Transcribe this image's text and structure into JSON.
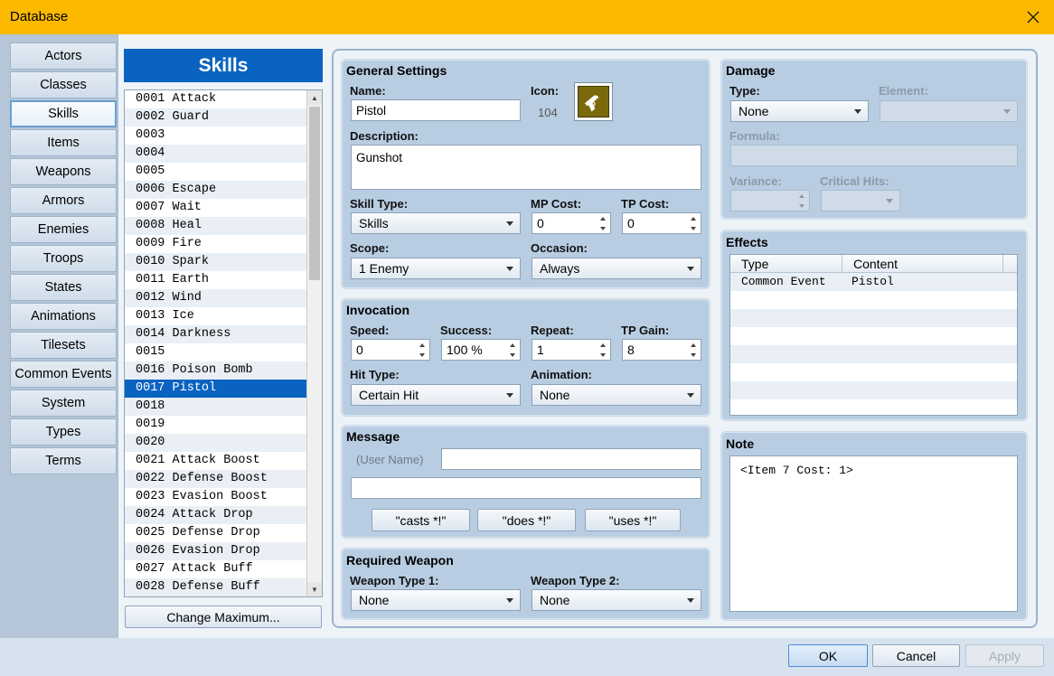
{
  "window": {
    "title": "Database",
    "close_icon": "close-icon"
  },
  "categories": [
    "Actors",
    "Classes",
    "Skills",
    "Items",
    "Weapons",
    "Armors",
    "Enemies",
    "Troops",
    "States",
    "Animations",
    "Tilesets",
    "Common Events",
    "System",
    "Types",
    "Terms"
  ],
  "active_category": "Skills",
  "list_panel": {
    "header": "Skills",
    "items": [
      "0001 Attack",
      "0002 Guard",
      "0003",
      "0004",
      "0005",
      "0006 Escape",
      "0007 Wait",
      "0008 Heal",
      "0009 Fire",
      "0010 Spark",
      "0011 Earth",
      "0012 Wind",
      "0013 Ice",
      "0014 Darkness",
      "0015",
      "0016 Poison Bomb",
      "0017 Pistol",
      "0018",
      "0019",
      "0020",
      "0021 Attack Boost",
      "0022 Defense Boost",
      "0023 Evasion Boost",
      "0024 Attack Drop",
      "0025 Defense Drop",
      "0026 Evasion Drop",
      "0027 Attack Buff",
      "0028 Defense Buff"
    ],
    "selected_index": 16,
    "change_max_label": "Change Maximum..."
  },
  "general": {
    "title": "General Settings",
    "name_label": "Name:",
    "name_value": "Pistol",
    "icon_label": "Icon:",
    "icon_index": "104",
    "description_label": "Description:",
    "description_value": "Gunshot",
    "skill_type_label": "Skill Type:",
    "skill_type_value": "Skills",
    "mp_cost_label": "MP Cost:",
    "mp_cost_value": "0",
    "tp_cost_label": "TP Cost:",
    "tp_cost_value": "0",
    "scope_label": "Scope:",
    "scope_value": "1 Enemy",
    "occasion_label": "Occasion:",
    "occasion_value": "Always"
  },
  "invocation": {
    "title": "Invocation",
    "speed_label": "Speed:",
    "speed_value": "0",
    "success_label": "Success:",
    "success_value": "100 %",
    "repeat_label": "Repeat:",
    "repeat_value": "1",
    "tp_gain_label": "TP Gain:",
    "tp_gain_value": "8",
    "hit_type_label": "Hit Type:",
    "hit_type_value": "Certain Hit",
    "animation_label": "Animation:",
    "animation_value": "None"
  },
  "message": {
    "title": "Message",
    "user_name_label": "(User Name)",
    "line1": "",
    "line2": "",
    "btn_casts": "\"casts *!\"",
    "btn_does": "\"does *!\"",
    "btn_uses": "\"uses *!\""
  },
  "required_weapon": {
    "title": "Required Weapon",
    "type1_label": "Weapon Type 1:",
    "type1_value": "None",
    "type2_label": "Weapon Type 2:",
    "type2_value": "None"
  },
  "damage": {
    "title": "Damage",
    "type_label": "Type:",
    "type_value": "None",
    "element_label": "Element:",
    "element_value": "",
    "formula_label": "Formula:",
    "formula_value": "",
    "variance_label": "Variance:",
    "variance_value": "",
    "critical_label": "Critical Hits:",
    "critical_value": ""
  },
  "effects": {
    "title": "Effects",
    "columns": [
      "Type",
      "Content"
    ],
    "rows": [
      {
        "type": "Common Event",
        "content": "Pistol"
      }
    ]
  },
  "note": {
    "title": "Note",
    "value": "<Item 7 Cost: 1>"
  },
  "footer": {
    "ok": "OK",
    "cancel": "Cancel",
    "apply": "Apply"
  }
}
